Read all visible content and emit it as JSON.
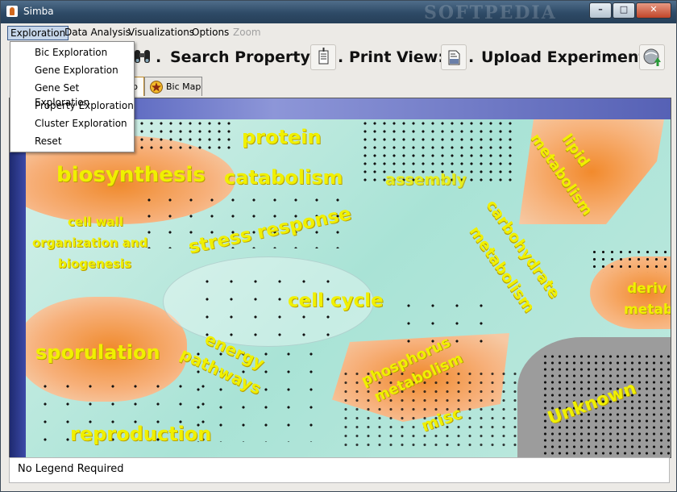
{
  "window": {
    "title": "Simba",
    "watermark": "SOFTPEDIA",
    "buttons": {
      "minimize": "–",
      "maximize": "□",
      "close": "✕"
    }
  },
  "menubar": {
    "items": [
      {
        "label": "Exploration",
        "state": "open"
      },
      {
        "label": "Data Analysis"
      },
      {
        "label": "Visualizations"
      },
      {
        "label": "Options"
      },
      {
        "label": "Zoom",
        "state": "disabled"
      }
    ]
  },
  "exploration_menu": {
    "items": [
      "Bic Exploration",
      "Gene Exploration",
      "Gene Set Exploration",
      "Property Exploration",
      "Cluster Exploration",
      "Reset"
    ]
  },
  "toolbar": {
    "search_label": "Search Property:",
    "print_label": "Print View:",
    "upload_label": "Upload Experiment:",
    "separator": ".",
    "icons": {
      "search": "binoculars-icon",
      "print": "print-document-icon",
      "view": "document-view-icon",
      "upload": "upload-globe-icon"
    }
  },
  "tabs": {
    "partial_label": "p",
    "bic_map": "Bic Map"
  },
  "map": {
    "labels": {
      "protein": "protein",
      "biosynthesis": "biosynthesis",
      "catabolism": "catabolism",
      "assembly": "assembly",
      "lipid": "lipid",
      "metabolism1": "metabolism",
      "cell_wall": "cell wall",
      "organization_and": "organization and",
      "biogenesis": "biogenesis",
      "stress_response": "stress response",
      "carbohydrate": "carbohydrate",
      "metabolism2": "metabolism",
      "cell_cycle": "cell cycle",
      "sporulation": "sporulation",
      "energy": "energy",
      "pathways": "pathways",
      "phosphorus": "phosphorus",
      "metabolism3": "metabolism",
      "reproduction": "reproduction",
      "misc": "misc",
      "unknown": "Unknown",
      "deriv": "deriv",
      "metab": "metab"
    }
  },
  "legend": {
    "text": "No Legend Required"
  },
  "colors": {
    "accent": "#3a49b0",
    "region_orange": "#f29a4e",
    "region_teal": "#bfe9df",
    "label_yellow": "#f0f000"
  }
}
